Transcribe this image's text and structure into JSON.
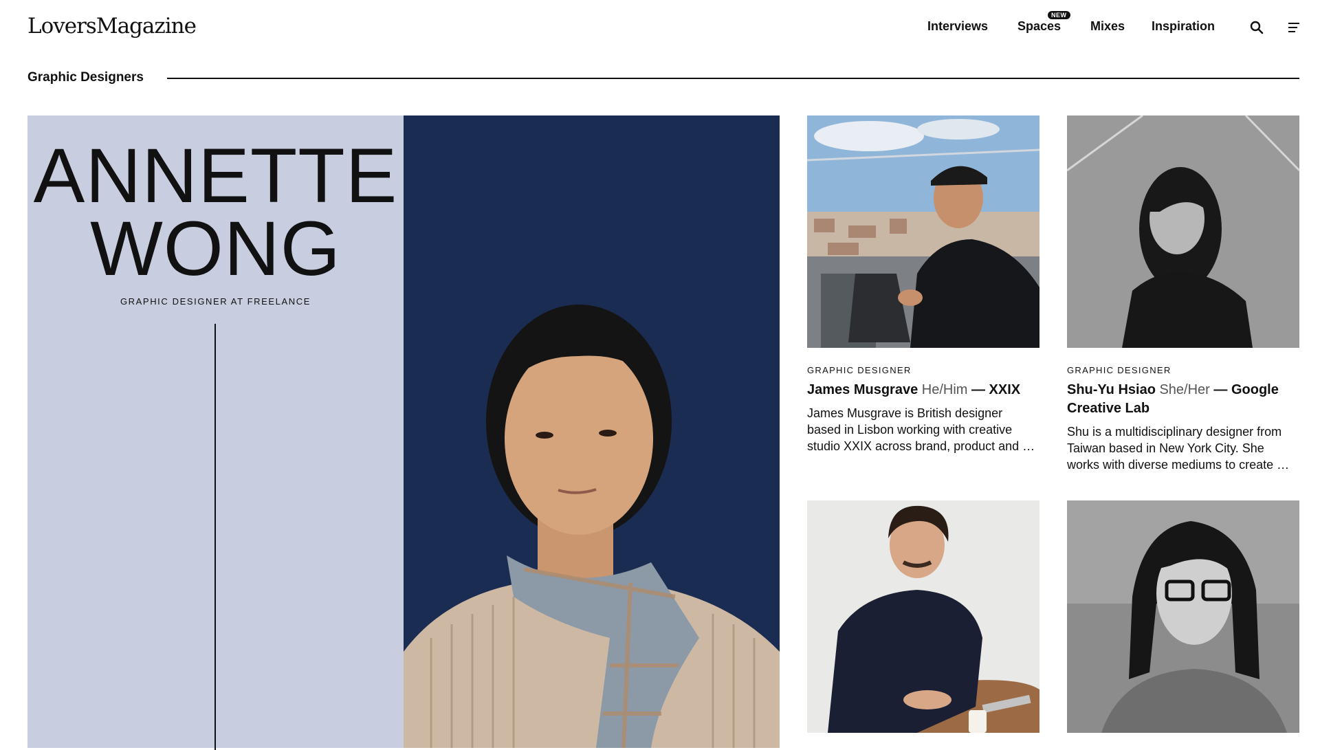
{
  "site": {
    "logo": "LoversMagazine"
  },
  "nav": {
    "items": [
      "Interviews",
      "Spaces",
      "Mixes",
      "Inspiration"
    ],
    "new_badge": "NEW"
  },
  "icons": {
    "search": "search-icon",
    "menu": "menu-icon"
  },
  "section": {
    "title": "Graphic Designers"
  },
  "feature": {
    "first_name": "ANNETTE",
    "last_name": "WONG",
    "role": "GRAPHIC DESIGNER AT FREELANCE",
    "panel_color": "#c8cde0",
    "photo_bg": "#1b2c52"
  },
  "cards": [
    {
      "category": "GRAPHIC DESIGNER",
      "name": "James Musgrave",
      "pronouns": "He/Him",
      "company": "— XXIX",
      "desc": "James Musgrave is British designer based in Lisbon working with creative studio XXIX across brand, product and …"
    },
    {
      "category": "GRAPHIC DESIGNER",
      "name": "Shu-Yu Hsiao",
      "pronouns": "She/Her",
      "company": "— Google Creative Lab",
      "desc": "Shu is a multidisciplinary designer from Taiwan based in New York City. She works with diverse mediums to create …"
    }
  ]
}
